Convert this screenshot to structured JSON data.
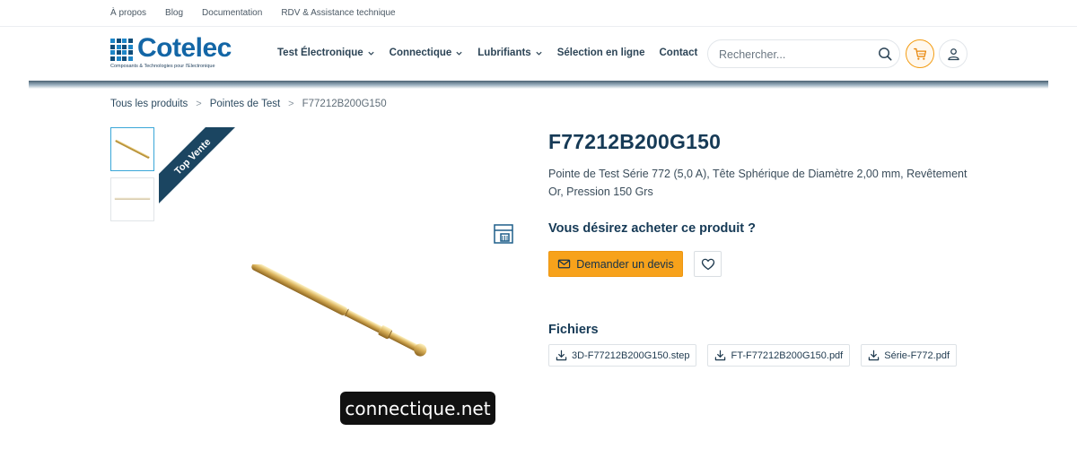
{
  "top_links": [
    "À propos",
    "Blog",
    "Documentation",
    "RDV & Assistance technique"
  ],
  "brand": {
    "name": "Cotelec",
    "tagline": "Composants & Technologies pour l'Electronique",
    "color": "#1366a6"
  },
  "nav": [
    {
      "label": "Test Électronique",
      "has_dropdown": true
    },
    {
      "label": "Connectique",
      "has_dropdown": true
    },
    {
      "label": "Lubrifiants",
      "has_dropdown": true
    },
    {
      "label": "Sélection en ligne",
      "has_dropdown": false
    },
    {
      "label": "Contact",
      "has_dropdown": false
    }
  ],
  "search": {
    "placeholder": "Rechercher...",
    "icon": "search-icon"
  },
  "header_icons": {
    "cart": "cart-icon",
    "account": "user-icon",
    "accent": "#f39c12"
  },
  "breadcrumb": {
    "items": [
      "Tous les produits",
      "Pointes de Test",
      "F77212B200G150"
    ],
    "separator": ">"
  },
  "gallery": {
    "badge": "Top Vente",
    "badge_color": "#1b4561",
    "thumbnails": [
      "probe-thumbnail",
      "probe-thumbnail"
    ],
    "active_index": 0
  },
  "product": {
    "sku": "F77212B200G150",
    "description": "Pointe de Test Série 772 (5,0 A), Tête Sphérique de Diamètre 2,00 mm, Revêtement Or, Pression 150 Grs",
    "buy_heading": "Vous désirez acheter ce produit ?",
    "quote_button": "Demander un devis",
    "quote_color": "#f7a21b"
  },
  "files": {
    "heading": "Fichiers",
    "items": [
      "3D-F77212B200G150.step",
      "FT-F77212B200G150.pdf",
      "Série-F772.pdf"
    ]
  },
  "watermark": "connectique.net"
}
